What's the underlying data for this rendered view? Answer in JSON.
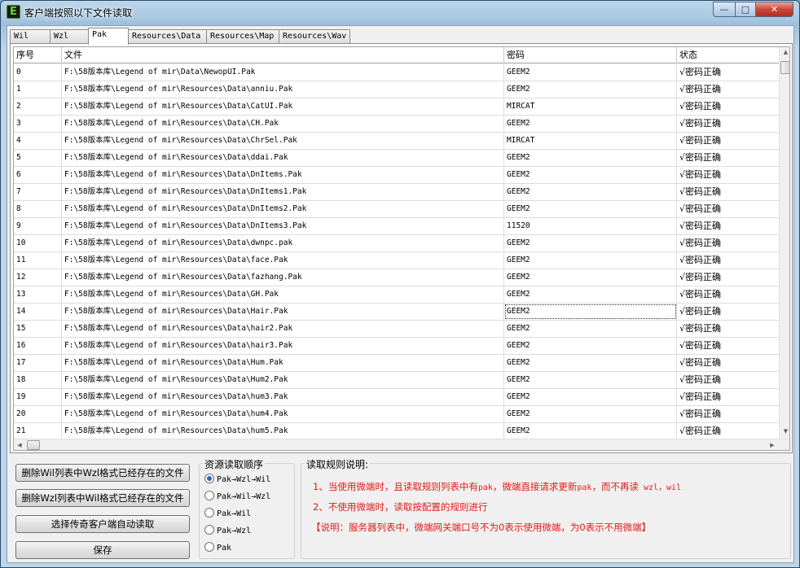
{
  "window": {
    "title": "客户端按照以下文件读取",
    "app_icon_letter": "E",
    "min_glyph": "—",
    "max_glyph": "□",
    "close_glyph": "✕"
  },
  "tabs": [
    "Wil",
    "Wzl",
    "Pak",
    "Resources\\Data",
    "Resources\\Map",
    "Resources\\Wav"
  ],
  "active_tab": "Pak",
  "table": {
    "headers": [
      "序号",
      "文件",
      "密码",
      "状态"
    ],
    "rows": [
      [
        "0",
        "F:\\58版本库\\Legend of mir\\Data\\NewopUI.Pak",
        "GEEM2",
        "√密码正确"
      ],
      [
        "1",
        "F:\\58版本库\\Legend of mir\\Resources\\Data\\anniu.Pak",
        "GEEM2",
        "√密码正确"
      ],
      [
        "2",
        "F:\\58版本库\\Legend of mir\\Resources\\Data\\CatUI.Pak",
        "MIRCAT",
        "√密码正确"
      ],
      [
        "3",
        "F:\\58版本库\\Legend of mir\\Resources\\Data\\CH.Pak",
        "GEEM2",
        "√密码正确"
      ],
      [
        "4",
        "F:\\58版本库\\Legend of mir\\Resources\\Data\\ChrSel.Pak",
        "MIRCAT",
        "√密码正确"
      ],
      [
        "5",
        "F:\\58版本库\\Legend of mir\\Resources\\Data\\ddai.Pak",
        "GEEM2",
        "√密码正确"
      ],
      [
        "6",
        "F:\\58版本库\\Legend of mir\\Resources\\Data\\DnItems.Pak",
        "GEEM2",
        "√密码正确"
      ],
      [
        "7",
        "F:\\58版本库\\Legend of mir\\Resources\\Data\\DnItems1.Pak",
        "GEEM2",
        "√密码正确"
      ],
      [
        "8",
        "F:\\58版本库\\Legend of mir\\Resources\\Data\\DnItems2.Pak",
        "GEEM2",
        "√密码正确"
      ],
      [
        "9",
        "F:\\58版本库\\Legend of mir\\Resources\\Data\\DnItems3.Pak",
        "11520",
        "√密码正确"
      ],
      [
        "10",
        "F:\\58版本库\\Legend of mir\\Resources\\Data\\dwnpc.pak",
        "GEEM2",
        "√密码正确"
      ],
      [
        "11",
        "F:\\58版本库\\Legend of mir\\Resources\\Data\\face.Pak",
        "GEEM2",
        "√密码正确"
      ],
      [
        "12",
        "F:\\58版本库\\Legend of mir\\Resources\\Data\\fazhang.Pak",
        "GEEM2",
        "√密码正确"
      ],
      [
        "13",
        "F:\\58版本库\\Legend of mir\\Resources\\Data\\GH.Pak",
        "GEEM2",
        "√密码正确"
      ],
      [
        "14",
        "F:\\58版本库\\Legend of mir\\Resources\\Data\\Hair.Pak",
        "GEEM2",
        "√密码正确"
      ],
      [
        "15",
        "F:\\58版本库\\Legend of mir\\Resources\\Data\\hair2.Pak",
        "GEEM2",
        "√密码正确"
      ],
      [
        "16",
        "F:\\58版本库\\Legend of mir\\Resources\\Data\\hair3.Pak",
        "GEEM2",
        "√密码正确"
      ],
      [
        "17",
        "F:\\58版本库\\Legend of mir\\Resources\\Data\\Hum.Pak",
        "GEEM2",
        "√密码正确"
      ],
      [
        "18",
        "F:\\58版本库\\Legend of mir\\Resources\\Data\\Hum2.Pak",
        "GEEM2",
        "√密码正确"
      ],
      [
        "19",
        "F:\\58版本库\\Legend of mir\\Resources\\Data\\hum3.Pak",
        "GEEM2",
        "√密码正确"
      ],
      [
        "20",
        "F:\\58版本库\\Legend of mir\\Resources\\Data\\hum4.Pak",
        "GEEM2",
        "√密码正确"
      ],
      [
        "21",
        "F:\\58版本库\\Legend of mir\\Resources\\Data\\hum5.Pak",
        "GEEM2",
        "√密码正确"
      ]
    ],
    "focused_row": 14
  },
  "buttons": {
    "delete_wil": "删除Wil列表中Wzl格式已经存在的文件",
    "delete_wzl": "删除Wzl列表中Wil格式已经存在的文件",
    "auto_read": "选择传奇客户端自动读取",
    "save": "保存"
  },
  "resource_order": {
    "title": "资源读取顺序",
    "options": [
      "Pak→Wzl→Wil",
      "Pak→Wil→Wzl",
      "Pak→Wil",
      "Pak→Wzl",
      "Pak"
    ],
    "selected_index": 0
  },
  "rules": {
    "title": "读取规则说明:",
    "line1_prefix": "1、当使用微端时，且读取规则列表中有",
    "line1_pak": "pak",
    "line1_mid": "，微端直接请求更新",
    "line1_pak2": "pak",
    "line1_suffix": "，而不再读",
    "line1_tail": " wzl，wil",
    "line2": "2、不使用微端时，读取按配置的规则进行",
    "line3": "【说明：服务器列表中，微端网关端口号不为0表示使用微端，为0表示不用微端】"
  }
}
